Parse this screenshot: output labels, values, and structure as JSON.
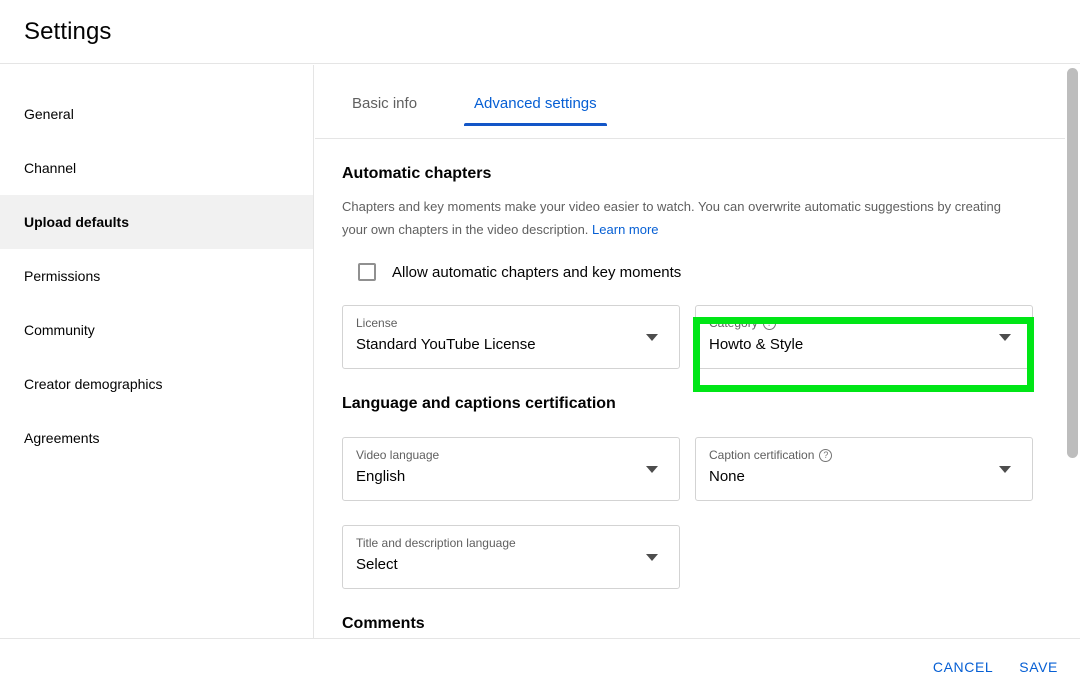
{
  "header": {
    "title": "Settings"
  },
  "sidebar": {
    "items": [
      {
        "label": "General",
        "active": false
      },
      {
        "label": "Channel",
        "active": false
      },
      {
        "label": "Upload defaults",
        "active": true
      },
      {
        "label": "Permissions",
        "active": false
      },
      {
        "label": "Community",
        "active": false
      },
      {
        "label": "Creator demographics",
        "active": false
      },
      {
        "label": "Agreements",
        "active": false
      }
    ]
  },
  "tabs": [
    {
      "label": "Basic info",
      "active": false
    },
    {
      "label": "Advanced settings",
      "active": true
    }
  ],
  "sections": {
    "automatic_chapters": {
      "title": "Automatic chapters",
      "description": "Chapters and key moments make your video easier to watch. You can overwrite automatic suggestions by creating your own chapters in the video description.",
      "learn_more": "Learn more",
      "checkbox_label": "Allow automatic chapters and key moments",
      "checkbox_checked": false
    },
    "language_captions": {
      "title": "Language and captions certification"
    },
    "comments": {
      "title": "Comments"
    }
  },
  "fields": {
    "license": {
      "label": "License",
      "value": "Standard YouTube License",
      "has_help": false
    },
    "category": {
      "label": "Category",
      "value": "Howto & Style",
      "has_help": true
    },
    "video_language": {
      "label": "Video language",
      "value": "English",
      "has_help": false
    },
    "caption_certification": {
      "label": "Caption certification",
      "value": "None",
      "has_help": true
    },
    "title_description_language": {
      "label": "Title and description language",
      "value": "Select",
      "has_help": false
    }
  },
  "icons": {
    "help": "?",
    "chevron_down": "chevron-down-icon"
  },
  "footer": {
    "cancel_label": "CANCEL",
    "save_label": "SAVE"
  },
  "colors": {
    "accent_blue": "#065fd4",
    "tab_underline": "#1356c7",
    "highlight_green": "#00e616",
    "sidebar_active_bg": "#f1f1f1"
  }
}
